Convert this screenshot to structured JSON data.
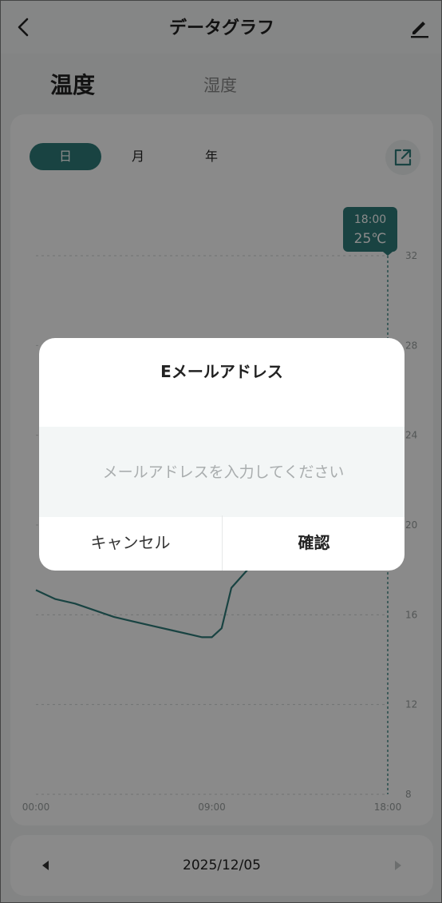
{
  "header": {
    "title": "データグラフ"
  },
  "tabs": [
    {
      "label": "温度"
    },
    {
      "label": "湿度"
    }
  ],
  "period_tabs": [
    {
      "label": "日"
    },
    {
      "label": "月"
    },
    {
      "label": "年"
    }
  ],
  "tooltip": {
    "time": "18:00",
    "value": "25℃"
  },
  "accent_color": "#2f7d7a",
  "chart_data": {
    "type": "line",
    "x_ticks": [
      "00:00",
      "09:00",
      "18:00"
    ],
    "y_ticks": [
      8,
      12,
      16,
      20,
      24,
      28,
      32
    ],
    "ylim": [
      8,
      32
    ],
    "xlim_hours": [
      0,
      18
    ],
    "series": [
      {
        "x": [
          0,
          0.5,
          1,
          2,
          3,
          4,
          5,
          6,
          7,
          8,
          8.5,
          9,
          9.5,
          10,
          18
        ],
        "values": [
          17.1,
          16.9,
          16.7,
          16.5,
          16.2,
          15.9,
          15.7,
          15.5,
          15.3,
          15.1,
          15.0,
          15.0,
          15.4,
          17.2,
          25.0
        ]
      }
    ]
  },
  "date": {
    "value": "2025/12/05"
  },
  "dialog": {
    "title": "Eメールアドレス",
    "placeholder": "メールアドレスを入力してください",
    "cancel_label": "キャンセル",
    "confirm_label": "確認"
  }
}
